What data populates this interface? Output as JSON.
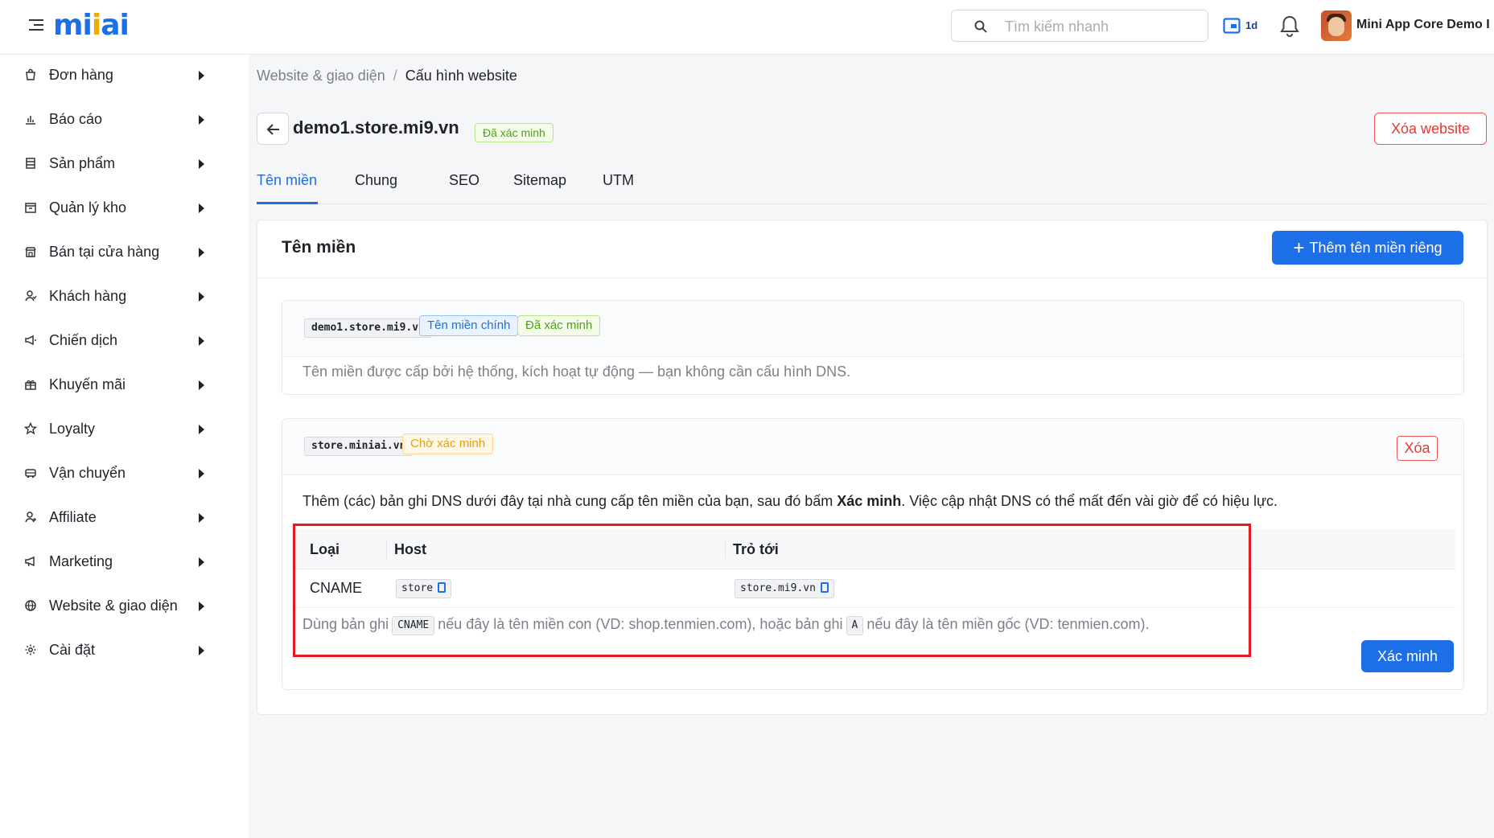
{
  "header": {
    "logo_text": "mi",
    "logo_text_tail": "ai",
    "logo_dot": "·",
    "search_placeholder": "Tìm kiếm nhanh",
    "calendar_label": "1d",
    "username": "Mini App Core Demo I",
    "colors": {
      "brand": "#1d6fe8",
      "accent": "#f2a900"
    }
  },
  "sidebar": {
    "items": [
      {
        "label": "Đơn hàng",
        "icon": "bag-icon"
      },
      {
        "label": "Báo cáo",
        "icon": "chart-icon"
      },
      {
        "label": "Sản phẩm",
        "icon": "box-icon"
      },
      {
        "label": "Quản lý kho",
        "icon": "warehouse-icon"
      },
      {
        "label": "Bán tại cửa hàng",
        "icon": "store-icon"
      },
      {
        "label": "Khách hàng",
        "icon": "users-icon"
      },
      {
        "label": "Chiến dịch",
        "icon": "megaphone-icon"
      },
      {
        "label": "Khuyến mãi",
        "icon": "gift-icon"
      },
      {
        "label": "Loyalty",
        "icon": "star-icon"
      },
      {
        "label": "Vận chuyển",
        "icon": "truck-icon"
      },
      {
        "label": "Affiliate",
        "icon": "affiliate-icon"
      },
      {
        "label": "Marketing",
        "icon": "bullhorn-icon"
      },
      {
        "label": "Website & giao diện",
        "icon": "globe-icon"
      },
      {
        "label": "Cài đặt",
        "icon": "gear-icon"
      }
    ]
  },
  "breadcrumb": {
    "parent": "Website & giao diện",
    "separator": "/",
    "current": "Cấu hình website"
  },
  "site": {
    "domain": "demo1.store.mi9.vn",
    "status": "Đã xác minh",
    "delete_label": "Xóa website"
  },
  "tabs": [
    "Tên miền",
    "Chung",
    "SEO",
    "Sitemap",
    "UTM"
  ],
  "domains_card": {
    "title": "Tên miền",
    "add_button": "Thêm tên miền riêng",
    "primary": {
      "domain": "demo1.store.mi9.vn",
      "badge_primary": "Tên miền chính",
      "badge_status": "Đã xác minh",
      "note": "Tên miền được cấp bởi hệ thống, kích hoạt tự động — bạn không cần cấu hình DNS."
    },
    "custom": {
      "domain": "store.miniai.vn",
      "badge_status": "Chờ xác minh",
      "delete_label": "Xóa",
      "instruction_pre": "Thêm (các) bản ghi DNS dưới đây tại nhà cung cấp tên miền của bạn, sau đó bấm ",
      "instruction_bold": "Xác minh",
      "instruction_post": ". Việc cập nhật DNS có thể mất đến vài giờ để có hiệu lực.",
      "table": {
        "headers": [
          "Loại",
          "Host",
          "Trỏ tới"
        ],
        "rows": [
          {
            "type": "CNAME",
            "host": "store",
            "target": "store.mi9.vn"
          }
        ]
      },
      "hint": {
        "p1": "Dùng bản ghi",
        "code1": "CNAME",
        "p2": "nếu đây là tên miền con (VD: shop.tenmien.com), hoặc bản ghi",
        "code2": "A",
        "p3": "nếu đây là tên miền gốc (VD: tenmien.com)."
      },
      "verify_button": "Xác minh"
    }
  }
}
